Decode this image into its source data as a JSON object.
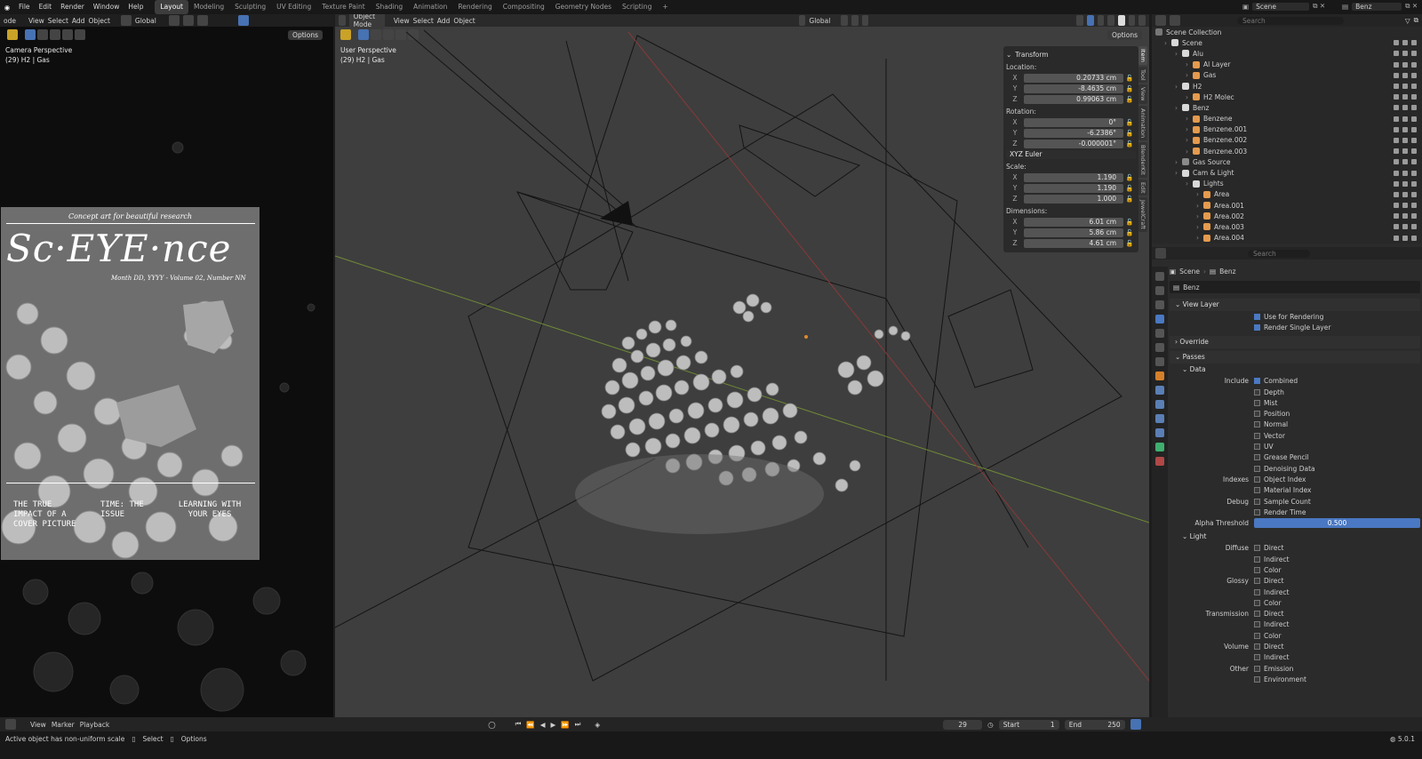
{
  "topbar": {
    "menus": [
      "File",
      "Edit",
      "Render",
      "Window",
      "Help"
    ],
    "workspaces": [
      "Layout",
      "Modeling",
      "Sculpting",
      "UV Editing",
      "Texture Paint",
      "Shading",
      "Animation",
      "Rendering",
      "Compositing",
      "Geometry Nodes",
      "Scripting"
    ],
    "active_workspace": "Layout",
    "plus": "+",
    "scene": "Scene",
    "view_layer": "Benz"
  },
  "left_view": {
    "mode": "ode",
    "menus": [
      "View",
      "Select",
      "Add",
      "Object"
    ],
    "orientation": "Global",
    "options": "Options",
    "label": "Camera Perspective",
    "sub": "(29) H2 | Gas"
  },
  "cover": {
    "tagline": "Concept art for beautiful research",
    "title": "Sc·EYE·nce",
    "issue": "Month DD, YYYY - Volume 02, Number NN",
    "h1": "THE TRUE IMPACT OF A COVER PICTURE",
    "h2": "TIME: THE ISSUE",
    "h3": "LEARNING WITH YOUR EYES"
  },
  "main_view": {
    "mode": "Object Mode",
    "menus": [
      "View",
      "Select",
      "Add",
      "Object"
    ],
    "orientation": "Global",
    "options": "Options",
    "label": "User Perspective",
    "sub": "(29) H2 | Gas"
  },
  "transform": {
    "title": "Transform",
    "location_label": "Location:",
    "location": [
      {
        "k": "X",
        "v": "0.20733 cm"
      },
      {
        "k": "Y",
        "v": "-8.4635 cm"
      },
      {
        "k": "Z",
        "v": "0.99063 cm"
      }
    ],
    "rotation_label": "Rotation:",
    "rotation": [
      {
        "k": "X",
        "v": "0°"
      },
      {
        "k": "Y",
        "v": "-6.2386°"
      },
      {
        "k": "Z",
        "v": "-0.000001°"
      }
    ],
    "euler": "XYZ Euler",
    "scale_label": "Scale:",
    "scale": [
      {
        "k": "X",
        "v": "1.190"
      },
      {
        "k": "Y",
        "v": "1.190"
      },
      {
        "k": "Z",
        "v": "1.000"
      }
    ],
    "dimensions_label": "Dimensions:",
    "dimensions": [
      {
        "k": "X",
        "v": "6.01 cm"
      },
      {
        "k": "Y",
        "v": "5.86 cm"
      },
      {
        "k": "Z",
        "v": "4.61 cm"
      }
    ]
  },
  "side_tabs": [
    "Item",
    "Tool",
    "View",
    "Animation",
    "BlenderKit",
    "Edit",
    "JewelCraft"
  ],
  "outliner": {
    "search": "Search",
    "root": "Scene Collection",
    "items": [
      {
        "depth": 0,
        "label": "Scene",
        "color": "#d9d9d9"
      },
      {
        "depth": 1,
        "label": "Alu",
        "color": "#d9d9d9"
      },
      {
        "depth": 2,
        "label": "Al Layer",
        "color": "#e59b4d"
      },
      {
        "depth": 2,
        "label": "Gas",
        "color": "#e59b4d"
      },
      {
        "depth": 1,
        "label": "H2",
        "color": "#d9d9d9"
      },
      {
        "depth": 2,
        "label": "H2 Molec",
        "color": "#e59b4d"
      },
      {
        "depth": 1,
        "label": "Benz",
        "color": "#d9d9d9"
      },
      {
        "depth": 2,
        "label": "Benzene",
        "color": "#e59b4d"
      },
      {
        "depth": 2,
        "label": "Benzene.001",
        "color": "#e59b4d"
      },
      {
        "depth": 2,
        "label": "Benzene.002",
        "color": "#e59b4d"
      },
      {
        "depth": 2,
        "label": "Benzene.003",
        "color": "#e59b4d"
      },
      {
        "depth": 1,
        "label": "Gas Source",
        "color": "#8a8a8a"
      },
      {
        "depth": 1,
        "label": "Cam & Light",
        "color": "#d9d9d9"
      },
      {
        "depth": 2,
        "label": "Lights",
        "color": "#d9d9d9"
      },
      {
        "depth": 3,
        "label": "Area",
        "color": "#e59b4d"
      },
      {
        "depth": 3,
        "label": "Area.001",
        "color": "#e59b4d"
      },
      {
        "depth": 3,
        "label": "Area.002",
        "color": "#e59b4d"
      },
      {
        "depth": 3,
        "label": "Area.003",
        "color": "#e59b4d"
      },
      {
        "depth": 3,
        "label": "Area.004",
        "color": "#e59b4d"
      }
    ]
  },
  "properties": {
    "search": "Search",
    "breadcrumb_scene": "Scene",
    "breadcrumb_layer": "Benz",
    "layer_name": "Benz",
    "view_layer": "View Layer",
    "use_rendering": "Use for Rendering",
    "render_single": "Render Single Layer",
    "override": "Override",
    "passes": "Passes",
    "data": "Data",
    "include": "Include",
    "include_items": [
      {
        "l": "Combined",
        "on": true
      },
      {
        "l": "Depth",
        "on": false
      },
      {
        "l": "Mist",
        "on": false
      },
      {
        "l": "Position",
        "on": false
      },
      {
        "l": "Normal",
        "on": false
      },
      {
        "l": "Vector",
        "on": false
      },
      {
        "l": "UV",
        "on": false
      },
      {
        "l": "Grease Pencil",
        "on": false
      },
      {
        "l": "Denoising Data",
        "on": false
      }
    ],
    "indexes": "Indexes",
    "index_items": [
      "Object Index",
      "Material Index"
    ],
    "debug": "Debug",
    "debug_items": [
      "Sample Count",
      "Render Time"
    ],
    "alpha_label": "Alpha Threshold",
    "alpha_value": "0.500",
    "light": "Light",
    "diffuse": "Diffuse",
    "diffuse_items": [
      "Direct",
      "Indirect",
      "Color"
    ],
    "glossy": "Glossy",
    "glossy_items": [
      "Direct",
      "Indirect",
      "Color"
    ],
    "transmission": "Transmission",
    "transmission_items": [
      "Direct",
      "Indirect",
      "Color"
    ],
    "volume": "Volume",
    "volume_items": [
      "Direct",
      "Indirect"
    ],
    "other": "Other",
    "other_items": [
      "Emission",
      "Environment"
    ]
  },
  "timeline": {
    "menus": [
      "View",
      "Marker",
      "Playback"
    ],
    "frame": "29",
    "start_label": "Start",
    "start": "1",
    "end_label": "End",
    "end": "250"
  },
  "status": {
    "msg": "Active object has non-uniform scale",
    "select": "Select",
    "options": "Options",
    "version": "5.0.1"
  }
}
